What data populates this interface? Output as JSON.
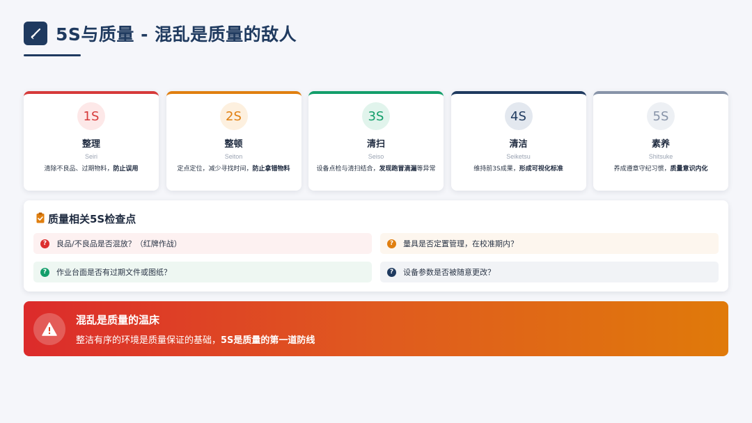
{
  "header": {
    "icon": "broom-icon",
    "title": "5S与质量 - 混乱是质量的敌人"
  },
  "cards": [
    {
      "badge": "1S",
      "name": "整理",
      "romaji": "Seiri",
      "desc": "清除不良品、过期物料，",
      "desc_bold": "防止误用",
      "color": "#d63a3a",
      "bg": "#fde8e8"
    },
    {
      "badge": "2S",
      "name": "整顿",
      "romaji": "Seiton",
      "desc": "定点定位，减少寻找时间，",
      "desc_bold": "防止拿错物料",
      "color": "#e07f10",
      "bg": "#fdf0df"
    },
    {
      "badge": "3S",
      "name": "清扫",
      "romaji": "Seiso",
      "desc": "设备点检与清扫结合，",
      "desc_bold": "发现跑冒滴漏",
      "desc_tail": "等异常",
      "color": "#139e6a",
      "bg": "#e1f4ec"
    },
    {
      "badge": "4S",
      "name": "清洁",
      "romaji": "Seiketsu",
      "desc": "维持前3S成果，",
      "desc_bold": "形成可视化标准",
      "color": "#1f3a5f",
      "bg": "#e3e8ef"
    },
    {
      "badge": "5S",
      "name": "素养",
      "romaji": "Shitsuke",
      "desc": "养成遵章守纪习惯，",
      "desc_bold": "质量意识内化",
      "color": "#8793a8",
      "bg": "#edf0f4"
    }
  ],
  "checkpoints": {
    "icon": "clipboard-check-icon",
    "title": "质量相关5S检查点",
    "items": [
      {
        "text": "良品/不良品是否混放？（红牌作战）",
        "icon": "question-circle-icon",
        "color": "#dc2f2f",
        "bg": "#fdf1f1"
      },
      {
        "text": "量具是否定置管理，在校准期内？",
        "icon": "question-circle-icon",
        "color": "#e07f10",
        "bg": "#fdf6ee"
      },
      {
        "text": "作业台面是否有过期文件或图纸？",
        "icon": "question-circle-icon",
        "color": "#139e6a",
        "bg": "#eef7f2"
      },
      {
        "text": "设备参数是否被随意更改？",
        "icon": "question-circle-icon",
        "color": "#1f3a5f",
        "bg": "#f1f3f6"
      }
    ]
  },
  "banner": {
    "icon": "warning-triangle-icon",
    "title": "混乱是质量的温床",
    "sub": "整洁有序的环境是质量保证的基础，",
    "sub_bold": "5S是质量的第一道防线"
  }
}
